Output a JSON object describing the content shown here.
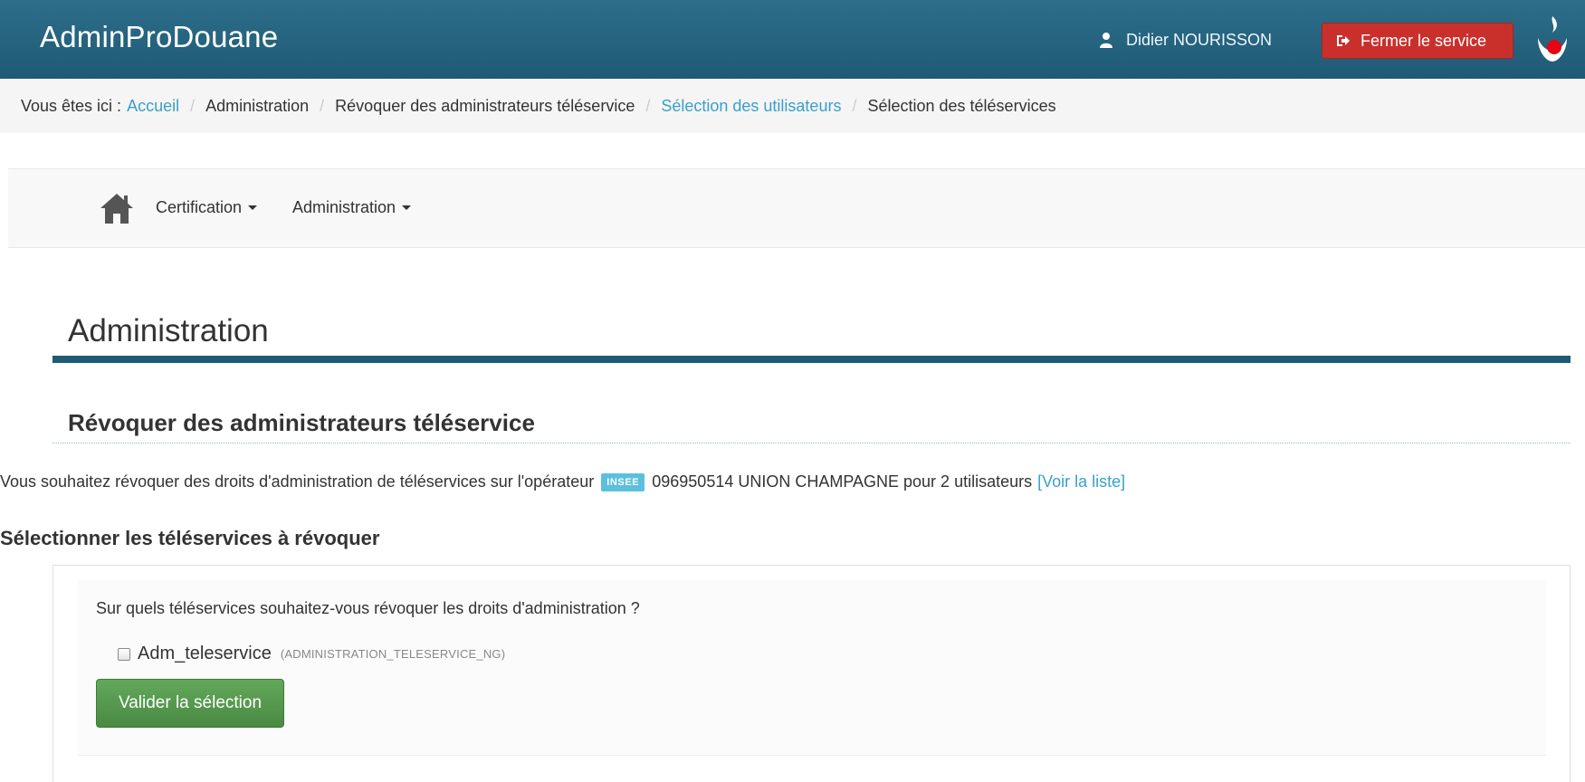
{
  "header": {
    "app_title": "AdminProDouane",
    "user_name": "Didier NOURISSON",
    "close_label": "Fermer le service",
    "colors": {
      "bar": "#1f5a75",
      "close": "#c9302c"
    }
  },
  "breadcrumb": {
    "prefix": "Vous êtes ici :",
    "items": [
      {
        "label": "Accueil",
        "link": true
      },
      {
        "label": "Administration",
        "link": false
      },
      {
        "label": "Révoquer des administrateurs téléservice",
        "link": false
      },
      {
        "label": "Sélection des utilisateurs",
        "link": true
      },
      {
        "label": "Sélection des téléservices",
        "link": false
      }
    ],
    "separator": "/"
  },
  "nav": {
    "items": [
      {
        "label": "Certification"
      },
      {
        "label": "Administration"
      }
    ]
  },
  "main": {
    "page_title": "Administration",
    "section_title": "Révoquer des administrateurs téléservice",
    "intro_text": "Vous souhaitez révoquer des droits d'administration de téléservices sur l'opérateur",
    "badge": "INSEE",
    "operator": "096950514 UNION CHAMPAGNE pour 2 utilisateurs",
    "list_link": "[Voir la liste]",
    "sub_title": "Sélectionner les téléservices à révoquer",
    "question": "Sur quels téléservices souhaitez-vous révoquer les droits d'administration ?",
    "teleservice": {
      "label": "Adm_teleservice",
      "code": "(ADMINISTRATION_TELESERVICE_NG)",
      "checked": false
    },
    "validate_label": "Valider la sélection"
  }
}
